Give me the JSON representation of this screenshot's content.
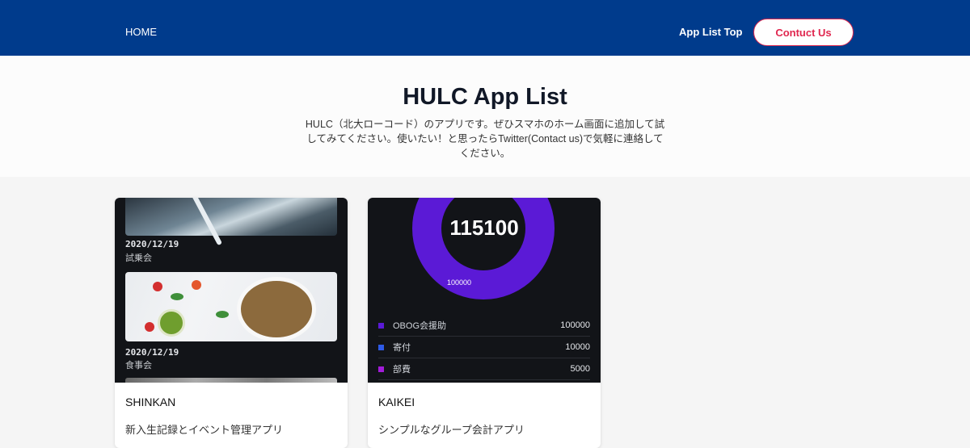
{
  "nav": {
    "home_label": "HOME",
    "app_list_label": "App List Top",
    "contact_label": "Contuct Us"
  },
  "hero": {
    "title": "HULC App List",
    "description_line1": "HULC（北大ローコード）のアプリです。ぜひスマホのホーム画面に追加して試",
    "description_line2": "してみてください。使いたい！と思ったらTwitter(Contact us)で気軽に連絡して",
    "description_line3": "ください。"
  },
  "cards": [
    {
      "title": "SHINKAN",
      "description": "新入生記録とイベント管理アプリ",
      "preview": {
        "events": [
          {
            "date": "2020/12/19",
            "name": "試乗会"
          },
          {
            "date": "2020/12/19",
            "name": "食事会"
          }
        ]
      }
    },
    {
      "title": "KAIKEI",
      "description": "シンプルなグループ会計アプリ",
      "preview": {
        "total": "115100",
        "donut_label": "100000",
        "items": [
          {
            "name": "OBOG会援助",
            "value": "100000",
            "color": "#5b1ad6"
          },
          {
            "name": "寄付",
            "value": "10000",
            "color": "#2e5ae6"
          },
          {
            "name": "部費",
            "value": "5000",
            "color": "#a21cd9"
          }
        ]
      }
    }
  ],
  "colors": {
    "nav_bg": "#003b8c",
    "contact_accent": "#e0274f",
    "donut_primary": "#5b1ad6",
    "card_preview_bg": "#121418"
  }
}
